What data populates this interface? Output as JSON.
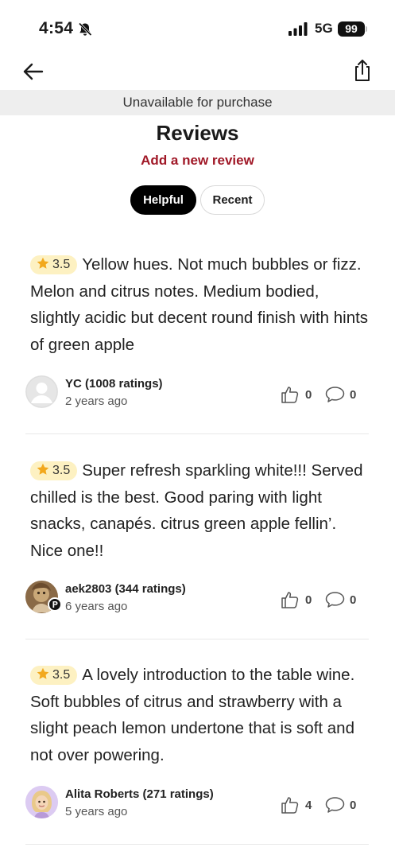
{
  "status_bar": {
    "time": "4:54",
    "network": "5G",
    "battery": "99"
  },
  "nav": {
    "back_icon": "arrow-left-icon",
    "share_icon": "share-icon"
  },
  "banner": {
    "text": "Unavailable for purchase"
  },
  "header": {
    "title": "Reviews",
    "add_review": "Add a new review"
  },
  "tabs": [
    {
      "label": "Helpful",
      "active": true
    },
    {
      "label": "Recent",
      "active": false
    }
  ],
  "colors": {
    "accent": "#a01827",
    "rating_badge_bg": "#fdf1c2",
    "star": "#f2a81d",
    "banner_bg": "#eeeeee"
  },
  "reviews": [
    {
      "rating": "3.5",
      "text": "Yellow hues. Not much bubbles or fizz. Melon and citrus notes. Medium bodied, slightly acidic but decent round finish with hints of green apple",
      "reviewer": "YC (1008 ratings)",
      "time": "2 years ago",
      "likes": "0",
      "comments": "0"
    },
    {
      "rating": "3.5",
      "text": "Super refresh sparkling white!!! Served chilled is the best. Good paring with light snacks, canapés.  citrus green apple fellin’. Nice one!!",
      "reviewer": "aek2803 (344 ratings)",
      "time": "6 years ago",
      "likes": "0",
      "comments": "0"
    },
    {
      "rating": "3.5",
      "text": "A lovely introduction to the table wine. Soft bubbles of citrus and strawberry with a slight peach lemon undertone that is soft and not over powering.",
      "reviewer": "Alita Roberts (271 ratings)",
      "time": "5 years ago",
      "likes": "4",
      "comments": "0"
    }
  ]
}
